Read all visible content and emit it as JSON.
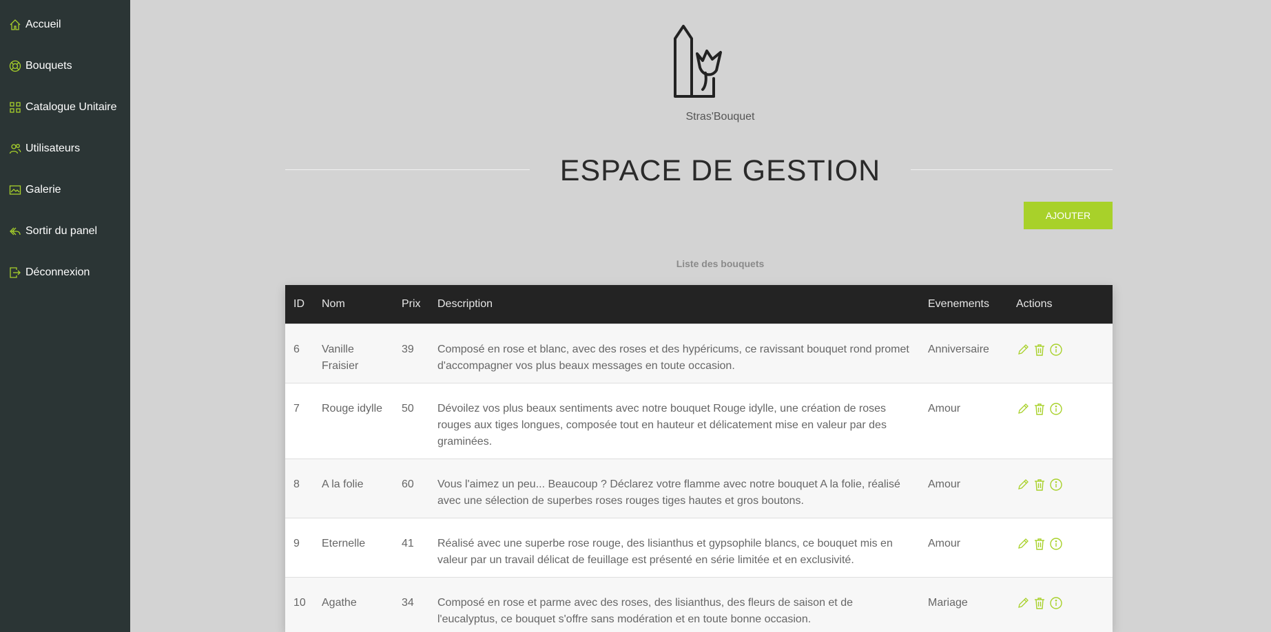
{
  "colors": {
    "accent": "#a8d12a",
    "sidebar_bg": "#2b3535",
    "page_bg": "#d3d3d3",
    "table_header_bg": "#232323"
  },
  "sidebar": {
    "items": [
      {
        "label": "Accueil",
        "icon": "home-icon"
      },
      {
        "label": "Bouquets",
        "icon": "lifebuoy-icon"
      },
      {
        "label": "Catalogue Unitaire",
        "icon": "grid-icon"
      },
      {
        "label": "Utilisateurs",
        "icon": "users-icon"
      },
      {
        "label": "Galerie",
        "icon": "image-icon"
      },
      {
        "label": "Sortir du panel",
        "icon": "reply-icon"
      },
      {
        "label": "Déconnexion",
        "icon": "logout-icon"
      }
    ]
  },
  "header": {
    "brand": "Stras'Bouquet",
    "title": "ESPACE DE GESTION"
  },
  "toolbar": {
    "add_label": "AJOUTER"
  },
  "table": {
    "caption": "Liste des bouquets",
    "columns": [
      "ID",
      "Nom",
      "Prix",
      "Description",
      "Evenements",
      "Actions"
    ],
    "rows": [
      {
        "id": "6",
        "nom": "Vanille Fraisier",
        "prix": "39",
        "description": "Composé en rose et blanc, avec des roses et des hypéricums, ce ravissant bouquet rond promet d'accompagner vos plus beaux messages en toute occasion.",
        "evenements": "Anniversaire"
      },
      {
        "id": "7",
        "nom": "Rouge idylle",
        "prix": "50",
        "description": "Dévoilez vos plus beaux sentiments avec notre bouquet Rouge idylle, une création de roses rouges aux tiges longues, composée tout en hauteur et délicatement mise en valeur par des graminées.",
        "evenements": "Amour"
      },
      {
        "id": "8",
        "nom": "A la folie",
        "prix": "60",
        "description": "Vous l'aimez un peu... Beaucoup ? Déclarez votre flamme avec notre bouquet A la folie, réalisé avec une sélection de superbes roses rouges tiges hautes et gros boutons.",
        "evenements": "Amour"
      },
      {
        "id": "9",
        "nom": "Eternelle",
        "prix": "41",
        "description": "Réalisé avec une superbe rose rouge, des lisianthus et gypsophile blancs, ce bouquet mis en valeur par un travail délicat de feuillage est présenté en série limitée et en exclusivité.",
        "evenements": "Amour"
      },
      {
        "id": "10",
        "nom": "Agathe",
        "prix": "34",
        "description": "Composé en rose et parme avec des roses, des lisianthus, des fleurs de saison et de l'eucalyptus, ce bouquet s'offre sans modération et en toute bonne occasion.",
        "evenements": "Mariage"
      }
    ]
  }
}
